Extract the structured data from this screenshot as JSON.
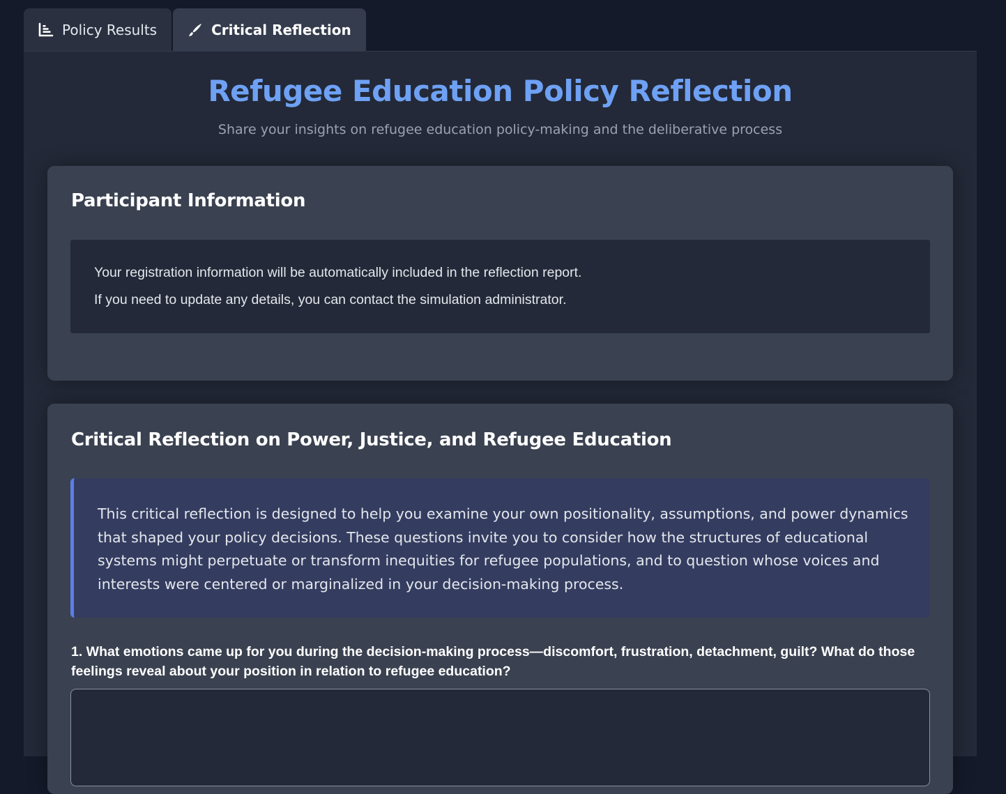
{
  "tabs": [
    {
      "label": "Policy Results",
      "icon": "bar-chart-icon",
      "active": false
    },
    {
      "label": "Critical Reflection",
      "icon": "pen-icon",
      "active": true
    }
  ],
  "header": {
    "title": "Refugee Education Policy Reflection",
    "subtitle": "Share your insights on refugee education policy-making and the deliberative process"
  },
  "participant": {
    "heading": "Participant Information",
    "lines": [
      "Your registration information will be automatically included in the reflection report.",
      "If you need to update any details, you can contact the simulation administrator."
    ]
  },
  "reflection": {
    "heading": "Critical Reflection on Power, Justice, and Refugee Education",
    "intro": "This critical reflection is designed to help you examine your own positionality, assumptions, and power dynamics that shaped your policy decisions. These questions invite you to consider how the structures of educational systems might perpetuate or transform inequities for refugee populations, and to question whose voices and interests were centered or marginalized in your decision-making process.",
    "questions": [
      {
        "label": "1. What emotions came up for you during the decision-making process—discomfort, frustration, detachment, guilt? What do those feelings reveal about your position in relation to refugee education?",
        "value": ""
      }
    ]
  },
  "colors": {
    "accent": "#6ea1f4",
    "callout_border": "#5b7ee8",
    "callout_bg": "#343d60",
    "card_bg": "#3a4150",
    "page_bg": "#141a2a"
  }
}
